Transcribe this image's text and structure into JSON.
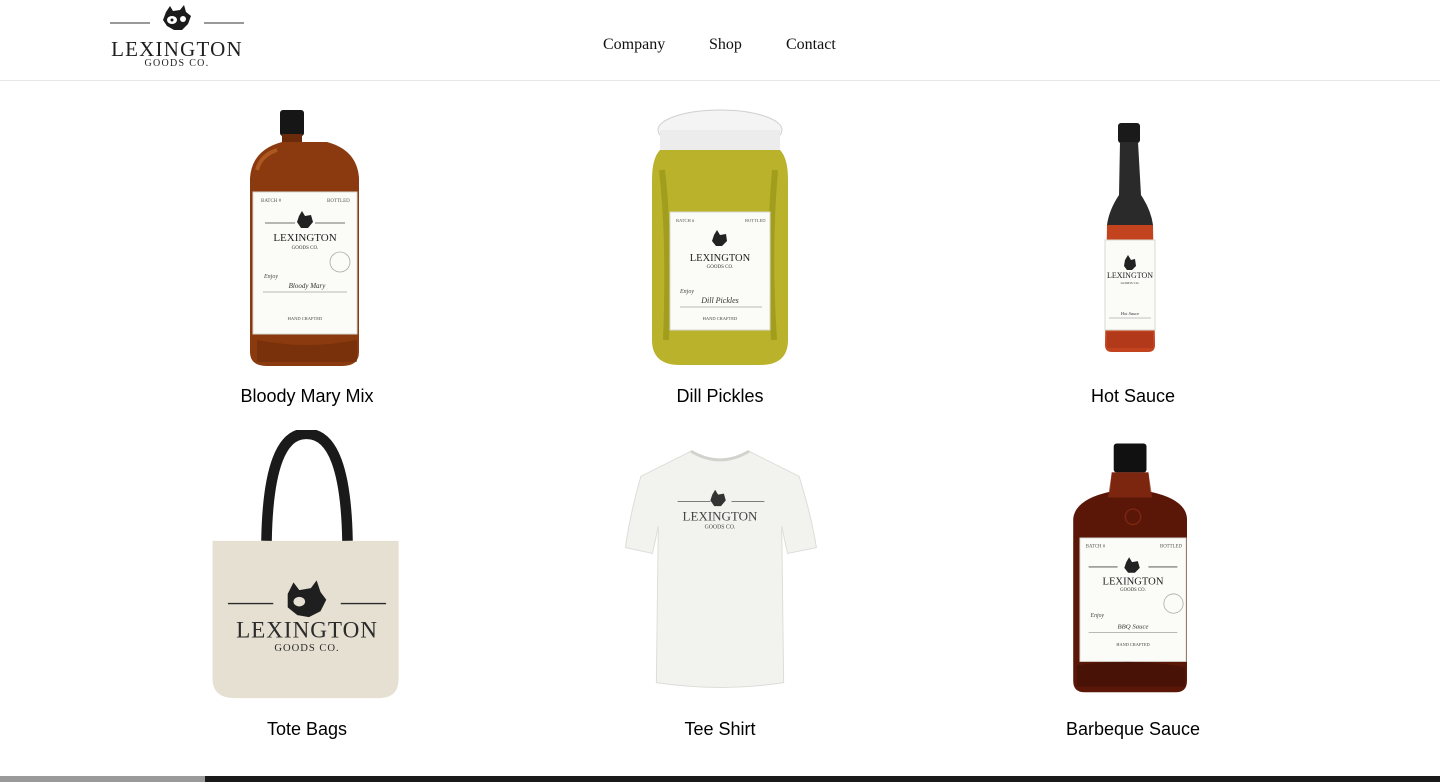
{
  "brand": {
    "name": "LEXINGTON",
    "subtitle": "GOODS CO."
  },
  "nav": {
    "items": [
      {
        "label": "Company"
      },
      {
        "label": "Shop"
      },
      {
        "label": "Contact"
      }
    ]
  },
  "products": [
    {
      "title": "Bloody Mary Mix",
      "label_script": "Bloody Mary",
      "icon": "amber-bottle"
    },
    {
      "title": "Dill Pickles",
      "label_script": "Dill Pickles",
      "icon": "pickle-jar"
    },
    {
      "title": "Hot Sauce",
      "label_script": "Hot Sauce",
      "icon": "hot-sauce-bottle"
    },
    {
      "title": "Tote Bags",
      "icon": "tote-bag"
    },
    {
      "title": "Tee Shirt",
      "icon": "tee-shirt"
    },
    {
      "title": "Barbeque Sauce",
      "label_script": "BBQ Sauce",
      "icon": "flask-bottle"
    }
  ],
  "label_text": {
    "batch": "BATCH #",
    "bottled": "BOTTLED",
    "enjoy": "Enjoy",
    "hand_crafted": "HAND CRAFTED"
  },
  "colors": {
    "amber": "#8a3a0e",
    "pickle": "#b9b22a",
    "hot_sauce": "#c2431d",
    "bbq": "#5a1708",
    "canvas": "#e6e0d3",
    "shirt": "#f2f2ef",
    "text": "#111111"
  }
}
